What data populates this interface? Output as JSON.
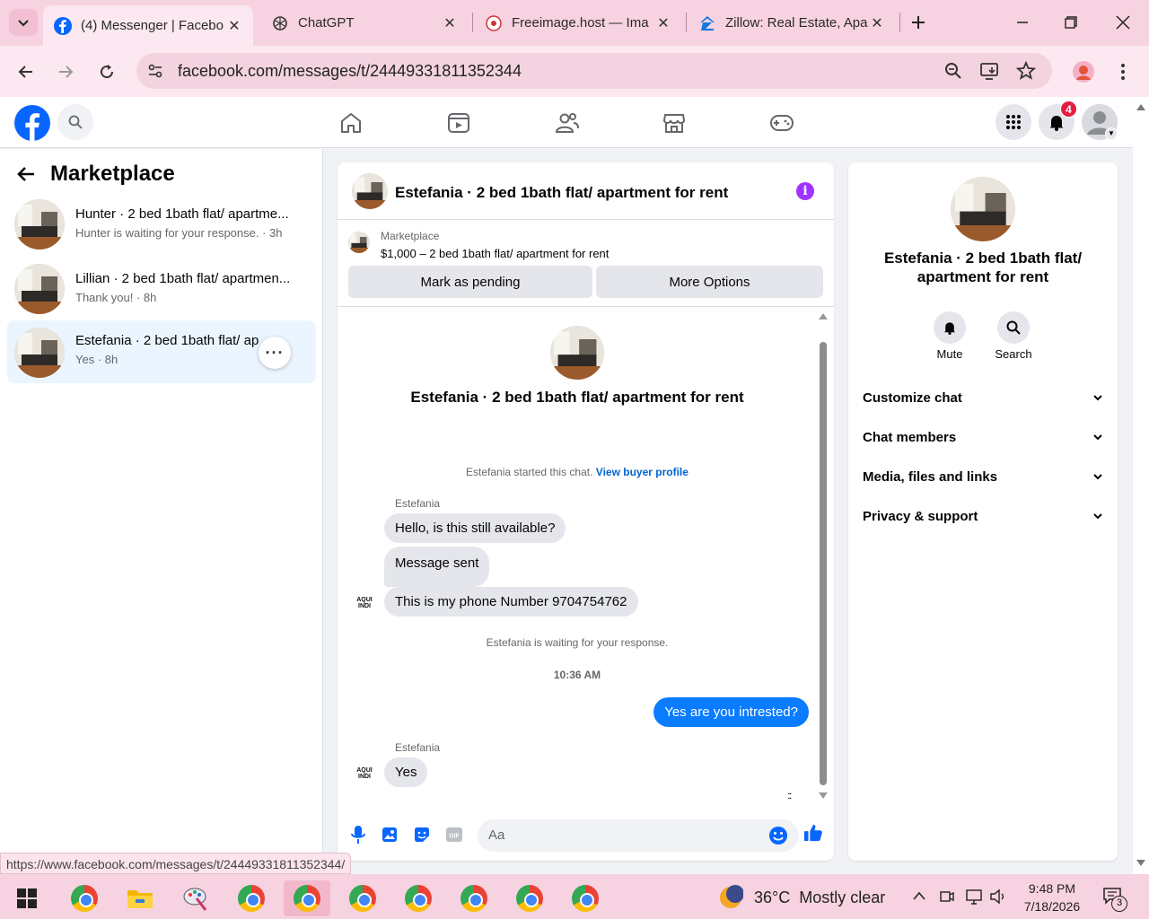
{
  "tabs": [
    {
      "label": "(4) Messenger | Facebo",
      "icon": "facebook-icon"
    },
    {
      "label": "ChatGPT",
      "icon": "chatgpt-icon"
    },
    {
      "label": "Freeimage.host — Ima",
      "icon": "freeimage-icon"
    },
    {
      "label": "Zillow: Real Estate, Apa",
      "icon": "zillow-icon"
    }
  ],
  "address": {
    "url": "facebook.com/messages/t/24449331811352344"
  },
  "notifications": {
    "count": "4"
  },
  "left": {
    "title": "Marketplace",
    "conversations": [
      {
        "name": "Hunter · 2 bed 1bath flat/ apartme...",
        "preview": "Hunter is waiting for your response. · 3h"
      },
      {
        "name": "Lillian · 2 bed 1bath flat/ apartmen...",
        "preview": "Thank you! · 8h"
      },
      {
        "name": "Estefania · 2 bed 1bath flat/ ap",
        "preview": "Yes · 8h"
      }
    ]
  },
  "chat": {
    "title": "Estefania · 2 bed 1bath flat/ apartment for rent",
    "listing": {
      "source": "Marketplace",
      "title": "$1,000 – 2 bed 1bath flat/ apartment for rent",
      "pending_label": "Mark as pending",
      "more_label": "More Options"
    },
    "profile_name": "Estefania · 2 bed 1bath flat/ apartment for rent",
    "started_text": "Estefania started this chat.",
    "buyer_link": "View buyer profile",
    "sender_name": "Estefania",
    "messages": [
      "Hello, is this still available?",
      "Message sent",
      "This is my phone Number 9704754762"
    ],
    "waiting_text": "Estefania is waiting for your response.",
    "timestamp": "10:36 AM",
    "my_message": "Yes are you intrested?",
    "sender_name_2": "Estefania",
    "reply": "Yes",
    "input_placeholder": "Aa"
  },
  "right": {
    "name": "Estefania · 2 bed 1bath flat/ apartment for rent",
    "mute_label": "Mute",
    "search_label": "Search",
    "sections": [
      "Customize chat",
      "Chat members",
      "Media, files and links",
      "Privacy & support"
    ]
  },
  "status_url": "https://www.facebook.com/messages/t/24449331811352344/",
  "taskbar": {
    "temperature": "36°C",
    "weather": "Mostly clear",
    "time": "9:48 PM",
    "date": "7/18/2026",
    "notifications": "3"
  },
  "colors": {
    "facebook_blue": "#0866ff",
    "bubble_mine": "#0a7cff",
    "info_purple": "#a033ff"
  }
}
